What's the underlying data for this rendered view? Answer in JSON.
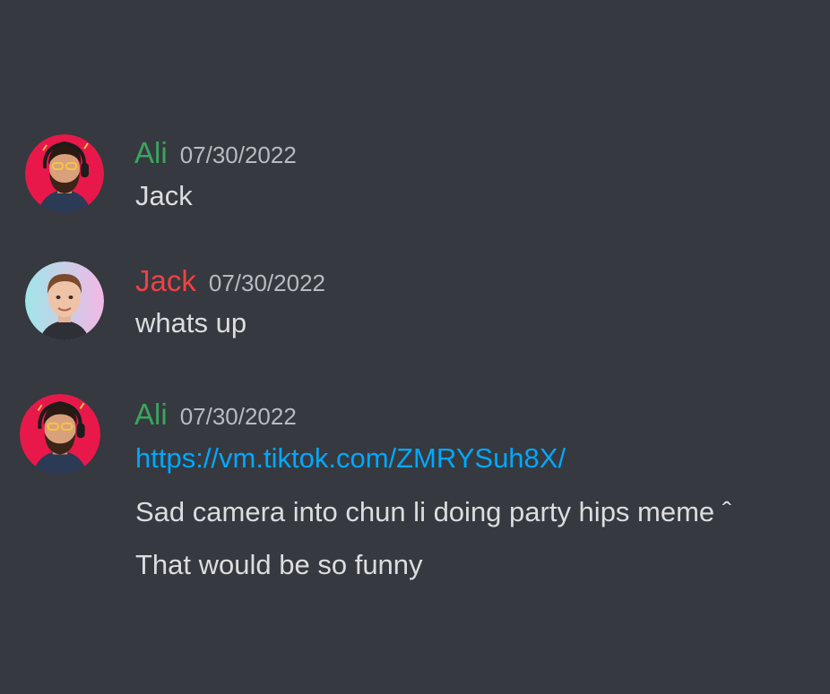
{
  "colors": {
    "background": "#36393f",
    "text": "#dcddde",
    "timestamp": "#b9bbbe",
    "link": "#00a8fc",
    "ali_name": "#3ba55d",
    "jack_name": "#ed4245"
  },
  "messages": [
    {
      "author": "Ali",
      "timestamp": "07/30/2022",
      "lines": [
        "Jack"
      ]
    },
    {
      "author": "Jack",
      "timestamp": "07/30/2022",
      "lines": [
        "whats up"
      ]
    },
    {
      "author": "Ali",
      "timestamp": "07/30/2022",
      "link": "https://vm.tiktok.com/ZMRYSuh8X/",
      "lines": [
        "Sad camera into chun li doing party hips meme ˆ",
        "That would be so funny"
      ]
    }
  ]
}
